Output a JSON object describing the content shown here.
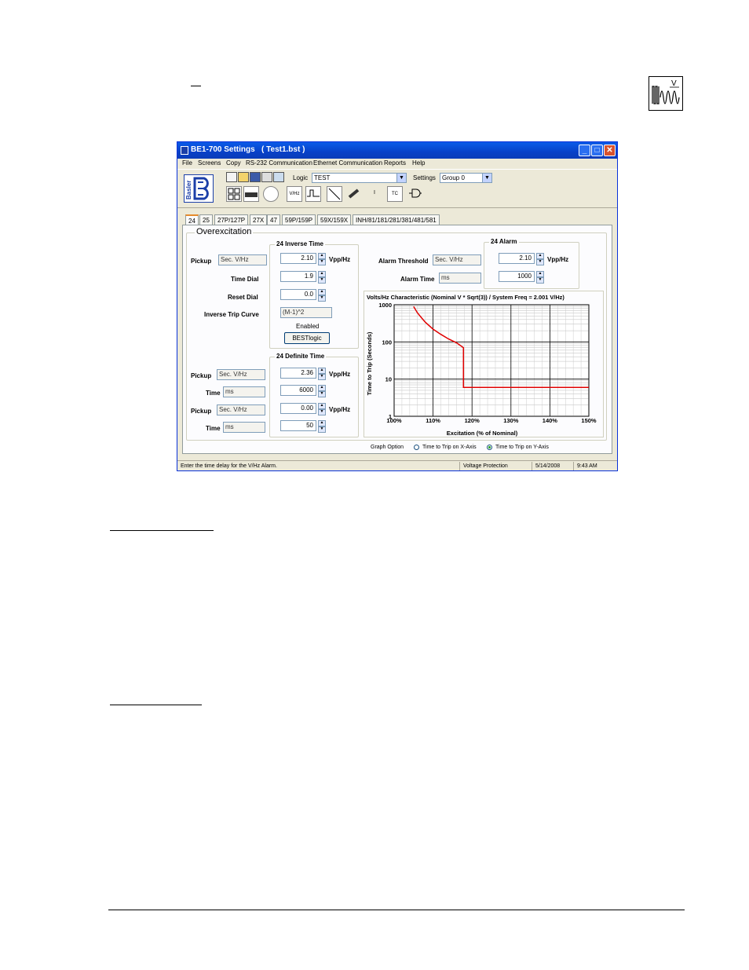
{
  "doc": {
    "top_mark": "_"
  },
  "window": {
    "title": "BE1-700 Settings   ( Test1.bst )",
    "controls": {
      "minimize": "_",
      "maximize": "□",
      "close": "✕"
    }
  },
  "menu": [
    "File",
    "Screens",
    "Copy",
    "RS-232 Communication",
    "Ethernet Communication",
    "Reports",
    "Help"
  ],
  "toolbar": {
    "logo_text": "Basler",
    "logic_label": "Logic",
    "logic_value": "TEST",
    "settings_label": "Settings",
    "settings_value": "Group 0",
    "icon_labels": {
      "vhz": "V/Hz",
      "tc": "TC",
      "i": "I"
    }
  },
  "tabs": [
    "24",
    "25",
    "27P/127P",
    "27X",
    "47",
    "59P/159P",
    "59X/159X",
    "INH/81/181/281/381/481/581"
  ],
  "active_tab": "24",
  "section_title": "Overexcitation",
  "inverse": {
    "group_title": "24 Inverse Time",
    "pickup_label": "Pickup",
    "pickup_unit": "Sec. V/Hz",
    "pickup_value": "2.10",
    "pickup_value_unit": "Vpp/Hz",
    "time_dial_label": "Time Dial",
    "time_dial_value": "1.9",
    "reset_dial_label": "Reset Dial",
    "reset_dial_value": "0.0",
    "curve_label": "Inverse Trip Curve",
    "curve_value": "(M-1)^2",
    "enabled_text": "Enabled",
    "bestlogic_button": "BESTlogic"
  },
  "definite": {
    "group_title": "24 Definite Time",
    "pickup1_label": "Pickup",
    "pickup1_unit": "Sec. V/Hz",
    "pickup1_value": "2.36",
    "pickup1_value_unit": "Vpp/Hz",
    "time1_label": "Time",
    "time1_unit": "ms",
    "time1_value": "6000",
    "pickup2_label": "Pickup",
    "pickup2_unit": "Sec. V/Hz",
    "pickup2_value": "0.00",
    "pickup2_value_unit": "Vpp/Hz",
    "time2_label": "Time",
    "time2_unit": "ms",
    "time2_value": "50"
  },
  "alarm": {
    "group_title": "24 Alarm",
    "threshold_label": "Alarm Threshold",
    "threshold_unit": "Sec. V/Hz",
    "threshold_value": "2.10",
    "threshold_value_unit": "Vpp/Hz",
    "time_label": "Alarm Time",
    "time_unit": "ms",
    "time_value": "1000"
  },
  "graph_option": {
    "label": "Graph Option",
    "opt_x": "Time to Trip on X-Axis",
    "opt_y": "Time to Trip on Y-Axis",
    "selected": "y"
  },
  "status": {
    "hint": "Enter the time delay for the V/Hz Alarm.",
    "mode": "Voltage Protection",
    "date": "5/14/2008",
    "time": "9:43 AM"
  },
  "colors": {
    "curve": "#e00000",
    "titlebar": "#0a5be8",
    "window_bg": "#ece9d8"
  },
  "chart_data": {
    "type": "line",
    "title": "Volts/Hz Characteristic (Nominal V * Sqrt(3)) / System Freq = 2.001 V/Hz)",
    "xlabel": "Excitation (% of Nominal)",
    "ylabel": "Time to Trip (Seconds)",
    "xlim": [
      100,
      150
    ],
    "ylim": [
      1,
      1000
    ],
    "y_scale": "log",
    "x_ticks": [
      "100%",
      "110%",
      "120%",
      "130%",
      "140%",
      "150%"
    ],
    "y_ticks": [
      "1",
      "10",
      "100",
      "1000"
    ],
    "grid": true,
    "series": [
      {
        "name": "",
        "x": [
          105,
          106,
          107,
          108,
          110,
          112,
          114,
          116,
          117.8,
          117.8,
          118.1,
          150
        ],
        "y": [
          900,
          600,
          450,
          340,
          220,
          160,
          120,
          95,
          70,
          6,
          6,
          6
        ]
      }
    ]
  }
}
